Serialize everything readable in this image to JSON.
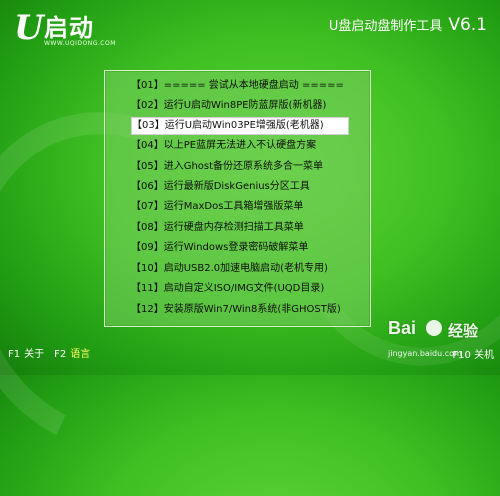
{
  "logo": {
    "mark": "U",
    "text": "启动",
    "url": "WWW.UQIDONG.COM"
  },
  "app_title": {
    "name": "U盘启动盘制作工具",
    "version": "V6.1"
  },
  "menu": {
    "selected_index": 2,
    "items": [
      "【01】===== 尝试从本地硬盘启动 =====",
      "【02】运行U启动Win8PE防蓝屏版(新机器)",
      "【03】运行U启动Win03PE增强版(老机器)",
      "【04】以上PE蓝屏无法进入不认硬盘方案",
      "【05】进入Ghost备份还原系统多合一菜单",
      "【06】运行最新版DiskGenius分区工具",
      "【07】运行MaxDos工具箱增强版菜单",
      "【08】运行硬盘内存检测扫描工具菜单",
      "【09】运行Windows登录密码破解菜单",
      "【10】启动USB2.0加速电脑启动(老机专用)",
      "【11】启动自定义ISO/IMG文件(UQD目录)",
      "【12】安装原版Win7/Win8系统(非GHOST版)"
    ]
  },
  "footer": {
    "f1_key": "F1",
    "f1_label": "关于",
    "f2_key": "F2",
    "f2_label": "语言",
    "right_text": "F10 关机"
  },
  "watermark": {
    "brand1": "Bai",
    "brand2": "经验",
    "url": "jingyan.baidu.com"
  },
  "colors": {
    "background": "#3fbf22",
    "selected_bg": "#ffffff",
    "lang_label": "#ffff66"
  }
}
